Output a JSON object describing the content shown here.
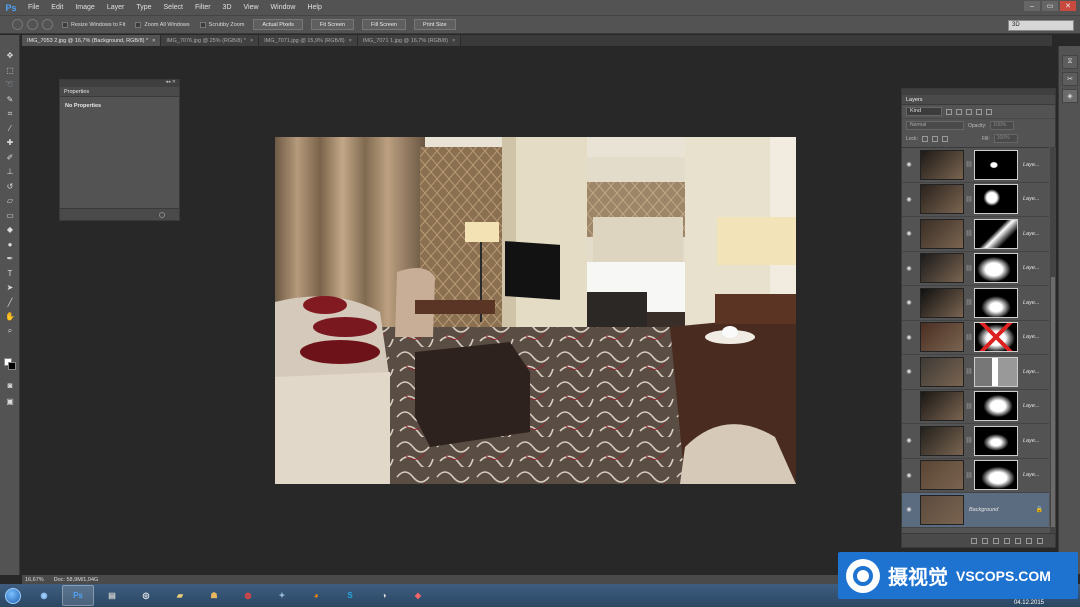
{
  "app": {
    "logo": "Ps"
  },
  "menu": [
    "File",
    "Edit",
    "Image",
    "Layer",
    "Type",
    "Select",
    "Filter",
    "3D",
    "View",
    "Window",
    "Help"
  ],
  "window_controls": [
    "–",
    "▭",
    "✕"
  ],
  "options_bar": {
    "checkboxes": [
      "Resize Windows to Fit",
      "Zoom All Windows",
      "Scrubby Zoom"
    ],
    "buttons": [
      "Actual Pixels",
      "Fit Screen",
      "Fill Screen",
      "Print Size"
    ],
    "workspace": "3D"
  },
  "tabs": [
    {
      "label": "IMG_7053 2.jpg @ 16,7% (Background, RGB/8) *",
      "active": true
    },
    {
      "label": "IMG_7076.jpg @ 25% (RGB/8) *",
      "active": false
    },
    {
      "label": "IMG_7071.jpg @ 15,9% (RGB/8)",
      "active": false
    },
    {
      "label": "IMG_7071 1.jpg @ 16,7% (RGB/8)",
      "active": false
    }
  ],
  "tab_close": "×",
  "properties": {
    "title": "Properties",
    "body": "No Properties",
    "collapse": "◂◂  ✕"
  },
  "layers": {
    "tab": "Layers",
    "kind": "Kind",
    "blend_mode": "Normal",
    "opacity_label": "Opacity:",
    "opacity_value": "100%",
    "lock_label": "Lock:",
    "fill_label": "Fill:",
    "fill_value": "100%",
    "items": [
      {
        "name": "Laye...",
        "visible": true
      },
      {
        "name": "Laye...",
        "visible": true
      },
      {
        "name": "Laye...",
        "visible": true
      },
      {
        "name": "Laye...",
        "visible": true
      },
      {
        "name": "Laye...",
        "visible": true
      },
      {
        "name": "Laye...",
        "visible": true
      },
      {
        "name": "Laye...",
        "visible": true
      },
      {
        "name": "Laye...",
        "visible": false
      },
      {
        "name": "Laye...",
        "visible": true
      },
      {
        "name": "Laye...",
        "visible": true
      },
      {
        "name": "Background",
        "visible": true,
        "locked": true
      }
    ]
  },
  "status": {
    "zoom": "16,67%",
    "doc": "Doc: 58,9M/1,04G"
  },
  "taskbar": {
    "date": "04.12.2015"
  },
  "watermark": {
    "cn": "摄视觉",
    "en": "VSCOPS.COM"
  }
}
